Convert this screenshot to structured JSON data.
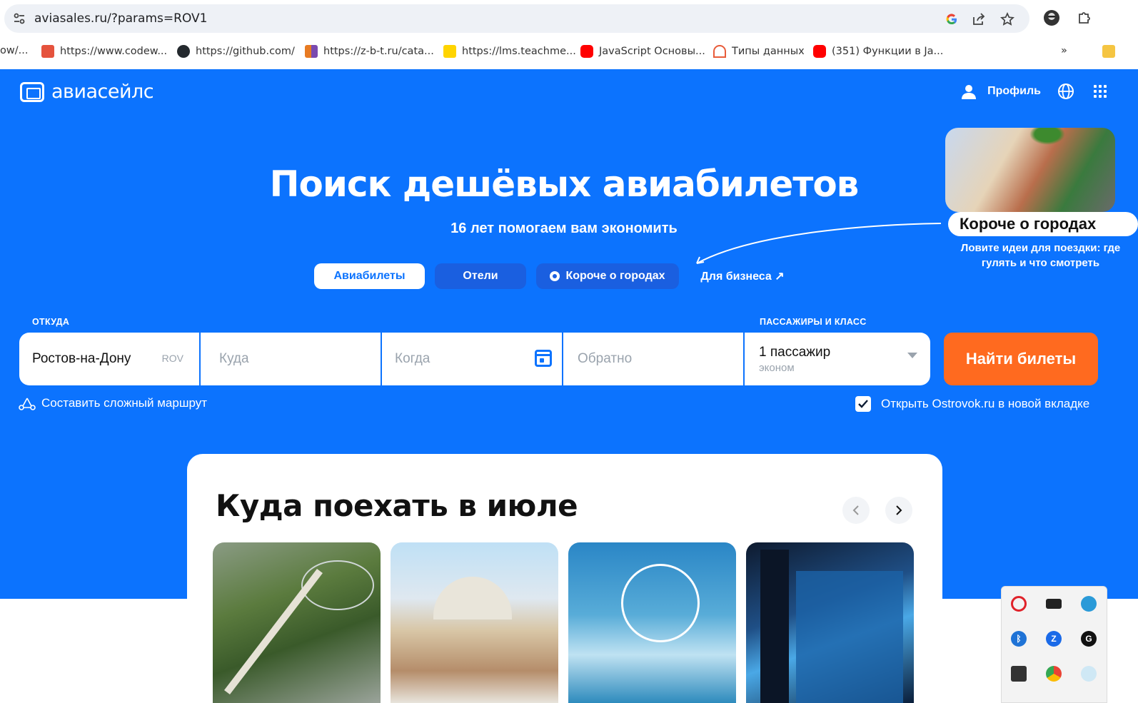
{
  "browser": {
    "url": "aviasales.ru/?params=ROV1",
    "bookmarks": [
      {
        "label": "ow/...",
        "color": "#888888"
      },
      {
        "label": "https://www.codew...",
        "color": "#e5533d"
      },
      {
        "label": "https://github.com/",
        "color": "#24292e"
      },
      {
        "label": "https://z-b-t.ru/cata...",
        "color": "#e87b22"
      },
      {
        "label": "https://lms.teachme...",
        "color": "#ffd400"
      },
      {
        "label": "JavaScript Основы...",
        "color": "#ff0000"
      },
      {
        "label": "Типы данных",
        "color": "#e85c3a"
      },
      {
        "label": "(351) Функции в Ja...",
        "color": "#ff0000"
      }
    ],
    "more": "»"
  },
  "header": {
    "logo_text": "авиасейлс",
    "profile_label": "Профиль"
  },
  "hero": {
    "title": "Поиск дешёвых авиабилетов",
    "subtitle": "16 лет помогаем вам экономить",
    "tabs": [
      {
        "label": "Авиабилеты",
        "active": true
      },
      {
        "label": "Отели",
        "active": false
      },
      {
        "label": "Короче о городах",
        "active": false
      },
      {
        "label": "Для бизнеса ↗",
        "active": false
      }
    ]
  },
  "promo": {
    "title": "Короче о городах",
    "description": "Ловите идеи для поездки: где гулять и что смотреть"
  },
  "search": {
    "label_from": "ОТКУДА",
    "label_pax": "ПАССАЖИРЫ И КЛАСС",
    "from_value": "Ростов-на-Дону",
    "from_code": "ROV",
    "to_placeholder": "Куда",
    "when_placeholder": "Когда",
    "return_placeholder": "Обратно",
    "passengers": "1 пассажир",
    "class": "эконом",
    "submit_label": "Найти билеты",
    "complex_route": "Составить сложный маршрут",
    "ostrovok": "Открыть Ostrovok.ru в новой вкладке",
    "ostrovok_checked": true
  },
  "destinations": {
    "title": "Куда поехать в июле",
    "prev": "‹",
    "next": "›"
  },
  "colors": {
    "brand_blue": "#0c73fe",
    "search_orange": "#ff6a1f"
  }
}
